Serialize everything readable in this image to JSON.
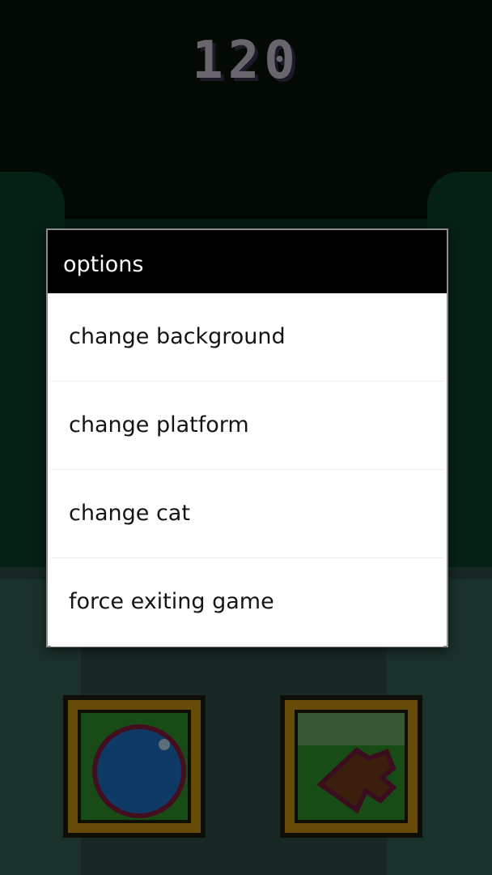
{
  "game": {
    "score": "120",
    "controls": [
      {
        "icon": "ball-icon"
      },
      {
        "icon": "turn-arrow-icon"
      }
    ]
  },
  "dialog": {
    "title": "options",
    "options": [
      {
        "label": "change background"
      },
      {
        "label": "change platform"
      },
      {
        "label": "change cat"
      },
      {
        "label": "force exiting game"
      }
    ]
  },
  "colors": {
    "dialog_title_bg": "#000000",
    "dialog_bg": "#ffffff",
    "score_text": "#bdb8c7",
    "control_frame": "#bb8b10"
  }
}
